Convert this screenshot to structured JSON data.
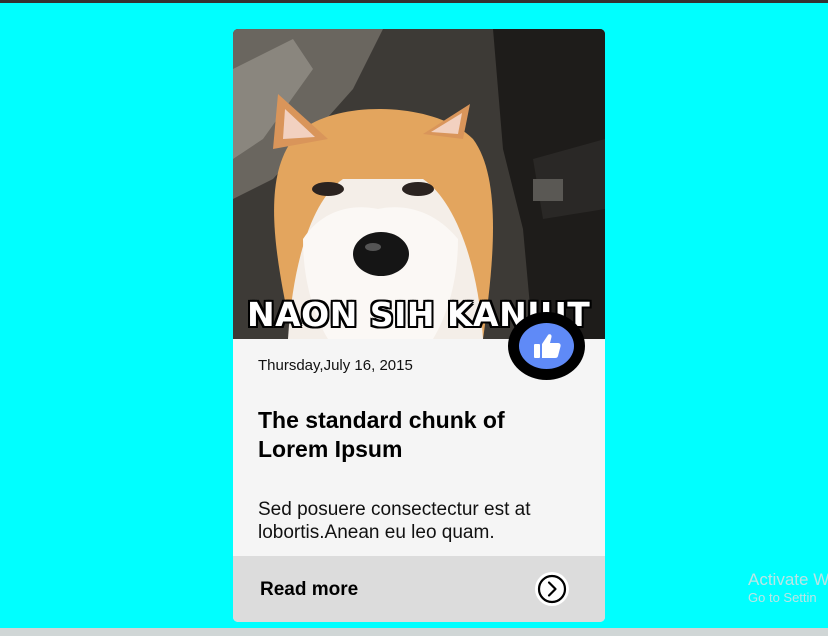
{
  "card": {
    "image_caption": "NAON SIH KANJUT",
    "date": "Thursday,July 16, 2015",
    "title": "The standard chunk of Lorem Ipsum",
    "excerpt": "Sed posuere consectectur est at lobortis.Anean eu leo quam.",
    "read_more_label": "Read more",
    "like_icon": "thumbs-up-icon",
    "arrow_icon": "chevron-right-circle-icon"
  },
  "watermark": {
    "title": "Activate W",
    "subtitle": "Go to Settin"
  },
  "colors": {
    "page_background": "#00ffff",
    "card_background": "#f5f5f5",
    "footer_background": "#dcdcdc",
    "like_button_fill": "#5f8af7"
  }
}
